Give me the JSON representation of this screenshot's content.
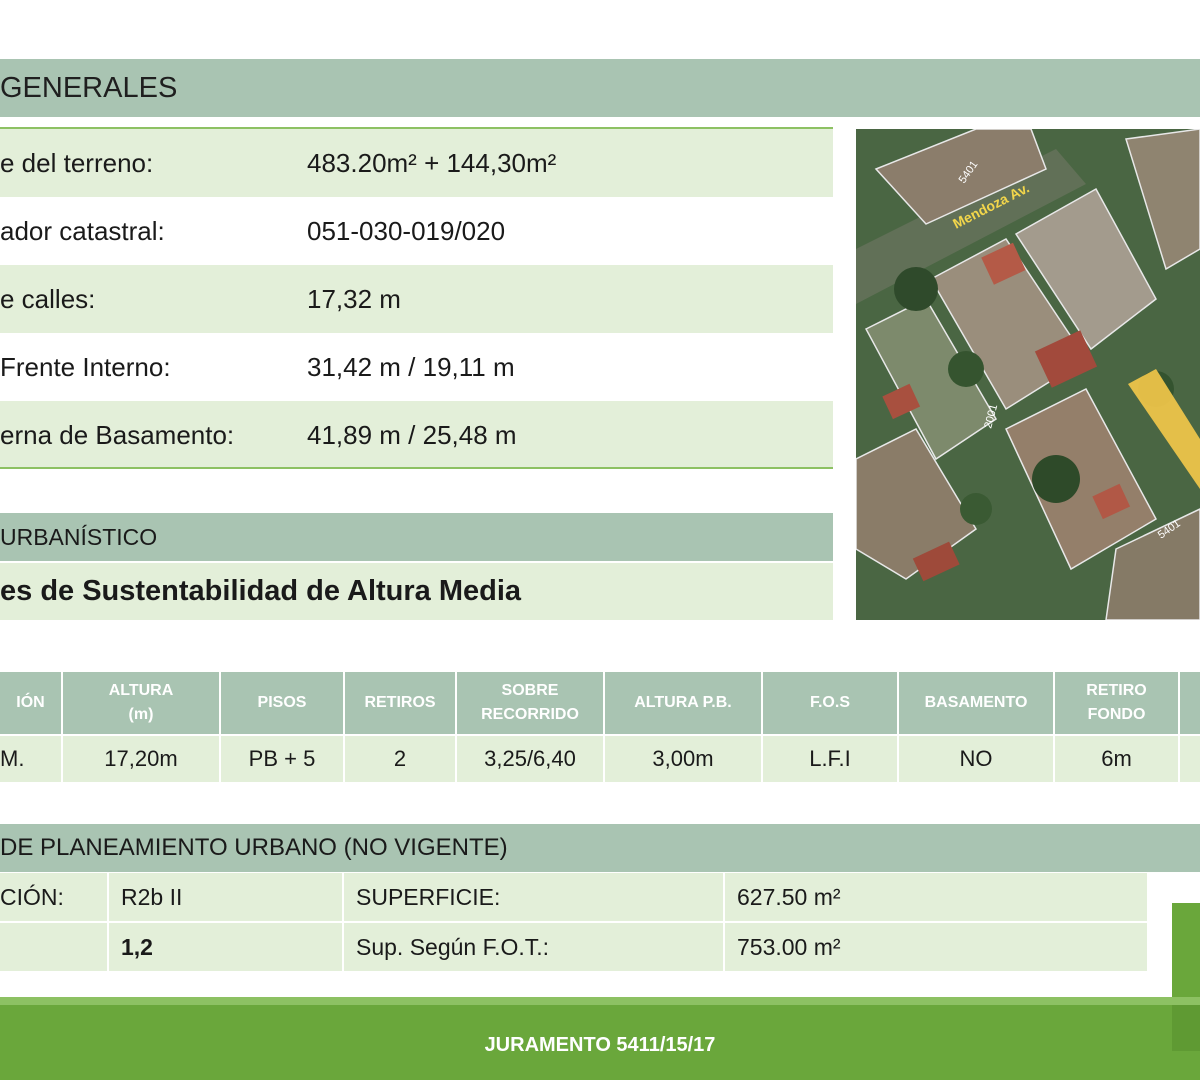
{
  "generales": {
    "title": "GENERALES",
    "rows": [
      {
        "label": "e del terreno:",
        "value": "483.20m² + 144,30m²"
      },
      {
        "label": "ador catastral:",
        "value": "051-030-019/020"
      },
      {
        "label": "e calles:",
        "value": "17,32 m"
      },
      {
        "label": " Frente Interno:",
        "value": "31,42 m / 19,11 m"
      },
      {
        "label": "erna de Basamento:",
        "value": "41,89 m / 25,48 m"
      }
    ]
  },
  "urbanistico": {
    "title": "URBANÍSTICO",
    "subtitle": "es de Sustentabilidad de Altura Media"
  },
  "map": {
    "labels": [
      "Mendoza Av.",
      "5401",
      "2001",
      "5401"
    ]
  },
  "zoning_table": {
    "headers": [
      "IÓN",
      "ALTURA\n(m)",
      "PISOS",
      "RETIROS",
      "SOBRE\nRECORRIDO",
      "ALTURA P.B.",
      "F.O.S",
      "BASAMENTO",
      "RETIRO\nFONDO",
      ""
    ],
    "values": [
      "M.",
      "17,20m",
      "PB + 5",
      "2",
      "3,25/6,40",
      "3,00m",
      "L.F.I",
      "NO",
      "6m",
      ""
    ]
  },
  "planeamiento": {
    "title": "DE PLANEAMIENTO URBANO (NO VIGENTE)",
    "rows": [
      {
        "c1": "CIÓN:",
        "c2": "R2b II",
        "c3": "SUPERFICIE:",
        "c4": "627.50 m²"
      },
      {
        "c1": "",
        "c2": "1,2",
        "c3": "Sup. Según F.O.T.:",
        "c4": "753.00 m²"
      }
    ]
  },
  "footer": {
    "text": "JURAMENTO 5411/15/17"
  },
  "colors": {
    "band": "#a9c4b2",
    "row_shade": "#e3efd9",
    "green_line": "#8dc163",
    "footer": "#6aa73b"
  }
}
